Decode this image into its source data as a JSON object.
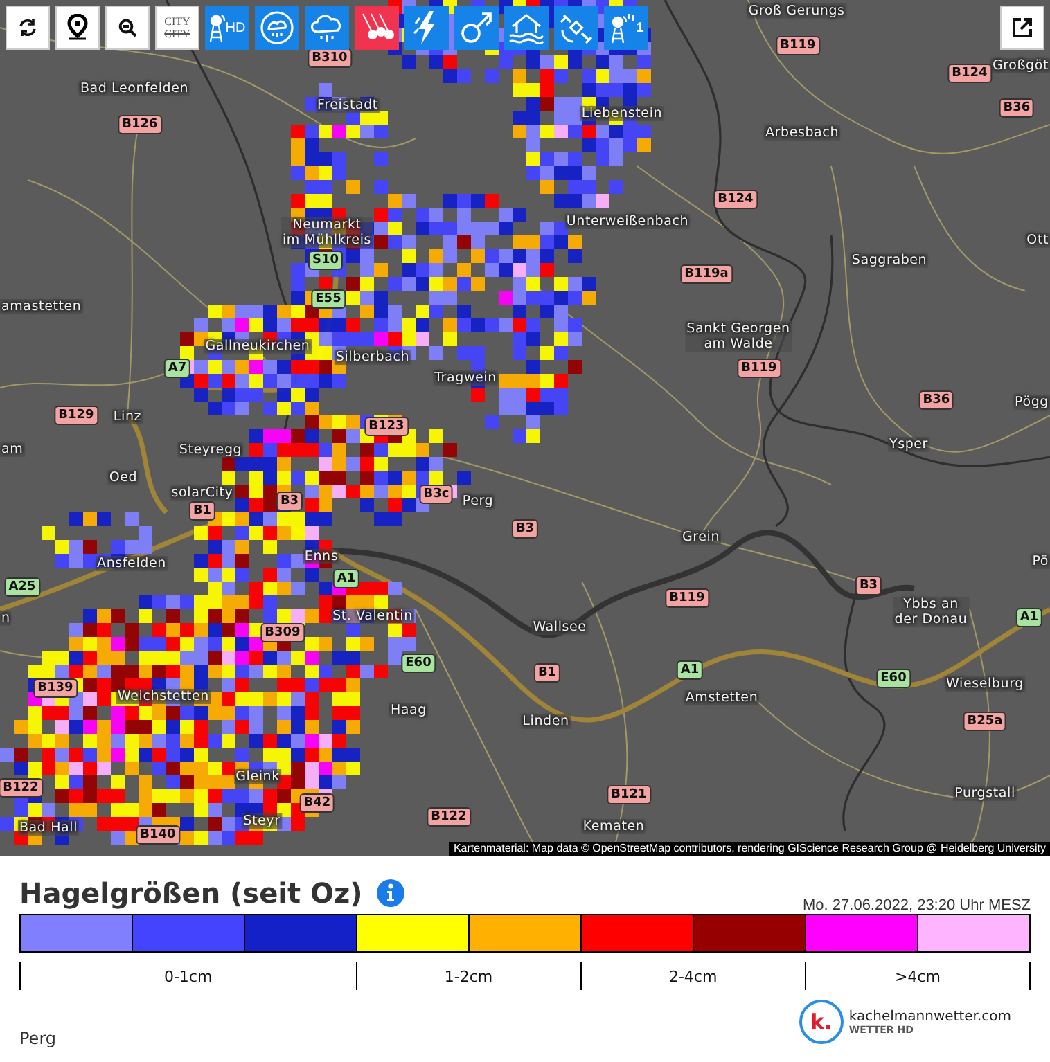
{
  "toolbar": {
    "tools": [
      {
        "kind": "refresh"
      },
      {
        "kind": "locate"
      },
      {
        "kind": "zoom"
      },
      {
        "kind": "city",
        "label": "CITY",
        "struck_label": "CITY"
      }
    ],
    "layers": [
      {
        "kind": "radar",
        "label": "HD",
        "selected": false
      },
      {
        "kind": "cell",
        "selected": false
      },
      {
        "kind": "rain",
        "selected": false
      },
      {
        "kind": "hail",
        "selected": true
      },
      {
        "kind": "lightning",
        "selected": false
      },
      {
        "kind": "meteor",
        "selected": false
      },
      {
        "kind": "flood",
        "selected": false
      },
      {
        "kind": "satellite",
        "selected": false
      },
      {
        "kind": "station",
        "label": "1",
        "selected": false
      }
    ]
  },
  "map": {
    "places": [
      {
        "lines": [
          "Groß Gerungs"
        ]
      },
      {
        "lines": [
          "Bad Leonfelden"
        ]
      },
      {
        "lines": [
          "Freistadt"
        ]
      },
      {
        "lines": [
          "Liebenstein"
        ]
      },
      {
        "lines": [
          "Arbesbach"
        ]
      },
      {
        "lines": [
          "Großgöt"
        ]
      },
      {
        "lines": [
          "Neumarkt",
          "im Mühlkreis"
        ]
      },
      {
        "lines": [
          "Unterweißenbach"
        ]
      },
      {
        "lines": [
          "Saggraben"
        ]
      },
      {
        "lines": [
          "Ott"
        ]
      },
      {
        "lines": [
          "amastetten"
        ]
      },
      {
        "lines": [
          "Gallneukirchen"
        ]
      },
      {
        "lines": [
          "Sankt Georgen",
          "am Walde"
        ]
      },
      {
        "lines": [
          "Silberbach"
        ]
      },
      {
        "lines": [
          "Tragwein"
        ]
      },
      {
        "lines": [
          "Linz"
        ]
      },
      {
        "lines": [
          "Ysper"
        ]
      },
      {
        "lines": [
          "Pögg"
        ]
      },
      {
        "lines": [
          "am"
        ]
      },
      {
        "lines": [
          "Steyregg"
        ]
      },
      {
        "lines": [
          "Oed"
        ]
      },
      {
        "lines": [
          "solarCity"
        ]
      },
      {
        "lines": [
          "Perg"
        ]
      },
      {
        "lines": [
          "Grein"
        ]
      },
      {
        "lines": [
          "Ansfelden"
        ]
      },
      {
        "lines": [
          "Enns"
        ]
      },
      {
        "lines": [
          "Pö"
        ]
      },
      {
        "lines": [
          "n"
        ]
      },
      {
        "lines": [
          "St. Valentin"
        ]
      },
      {
        "lines": [
          "Wallsee"
        ]
      },
      {
        "lines": [
          "Ybbs an",
          "der Donau"
        ]
      },
      {
        "lines": [
          "Weichstetten"
        ]
      },
      {
        "lines": [
          "Haag"
        ]
      },
      {
        "lines": [
          "Amstetten"
        ]
      },
      {
        "lines": [
          "Wieselburg"
        ]
      },
      {
        "lines": [
          "Linden"
        ]
      },
      {
        "lines": [
          "Gleink"
        ]
      },
      {
        "lines": [
          "Purgstall"
        ]
      },
      {
        "lines": [
          "Bad Hall"
        ]
      },
      {
        "lines": [
          "Steyr"
        ]
      },
      {
        "lines": [
          "Kematen"
        ]
      }
    ],
    "shields": [
      {
        "label": "B310",
        "kind": "federal"
      },
      {
        "label": "B119",
        "kind": "federal"
      },
      {
        "label": "B124",
        "kind": "federal"
      },
      {
        "label": "B126",
        "kind": "federal"
      },
      {
        "label": "B36",
        "kind": "federal"
      },
      {
        "label": "B124",
        "kind": "federal"
      },
      {
        "label": "S10",
        "kind": "motorway"
      },
      {
        "label": "E55",
        "kind": "motorway"
      },
      {
        "label": "B119a",
        "kind": "federal"
      },
      {
        "label": "B119",
        "kind": "federal"
      },
      {
        "label": "A7",
        "kind": "motorway"
      },
      {
        "label": "B129",
        "kind": "federal"
      },
      {
        "label": "B36",
        "kind": "federal"
      },
      {
        "label": "B123",
        "kind": "federal"
      },
      {
        "label": "B3c",
        "kind": "federal"
      },
      {
        "label": "B3",
        "kind": "federal"
      },
      {
        "label": "B1",
        "kind": "federal"
      },
      {
        "label": "B3",
        "kind": "federal"
      },
      {
        "label": "A25",
        "kind": "motorway"
      },
      {
        "label": "A1",
        "kind": "motorway"
      },
      {
        "label": "B119",
        "kind": "federal"
      },
      {
        "label": "B3",
        "kind": "federal"
      },
      {
        "label": "A1",
        "kind": "motorway"
      },
      {
        "label": "B309",
        "kind": "federal"
      },
      {
        "label": "E60",
        "kind": "motorway"
      },
      {
        "label": "B1",
        "kind": "federal"
      },
      {
        "label": "A1",
        "kind": "motorway"
      },
      {
        "label": "E60",
        "kind": "motorway"
      },
      {
        "label": "B139",
        "kind": "federal"
      },
      {
        "label": "B25a",
        "kind": "federal"
      },
      {
        "label": "B122",
        "kind": "federal"
      },
      {
        "label": "B42",
        "kind": "federal"
      },
      {
        "label": "B122",
        "kind": "federal"
      },
      {
        "label": "B121",
        "kind": "federal"
      },
      {
        "label": "B140",
        "kind": "federal"
      }
    ],
    "attribution": "Kartenmaterial: Map data © OpenStreetMap contributors, rendering GIScience Research Group @ Heidelberg University"
  },
  "legend": {
    "title": "Hagelgrößen (seit Oz)",
    "timestamp": "Mo. 27.06.2022, 23:20 Uhr MESZ",
    "groups": [
      {
        "label": "0-1cm",
        "swatches": [
          {
            "color": "#8080ff"
          },
          {
            "color": "#4444ff"
          },
          {
            "color": "#1420c8"
          }
        ]
      },
      {
        "label": "1-2cm",
        "swatches": [
          {
            "color": "#ffff00"
          },
          {
            "color": "#ffb000"
          }
        ]
      },
      {
        "label": "2-4cm",
        "swatches": [
          {
            "color": "#ff0000"
          },
          {
            "color": "#960000"
          }
        ]
      },
      {
        "label": ">4cm",
        "swatches": [
          {
            "color": "#ff00ff"
          },
          {
            "color": "#ffb4ff"
          }
        ]
      }
    ]
  },
  "location": "Perg",
  "brand": {
    "mark": "k.",
    "name": "kachelmannwetter.com",
    "tagline": "WETTER HD"
  }
}
